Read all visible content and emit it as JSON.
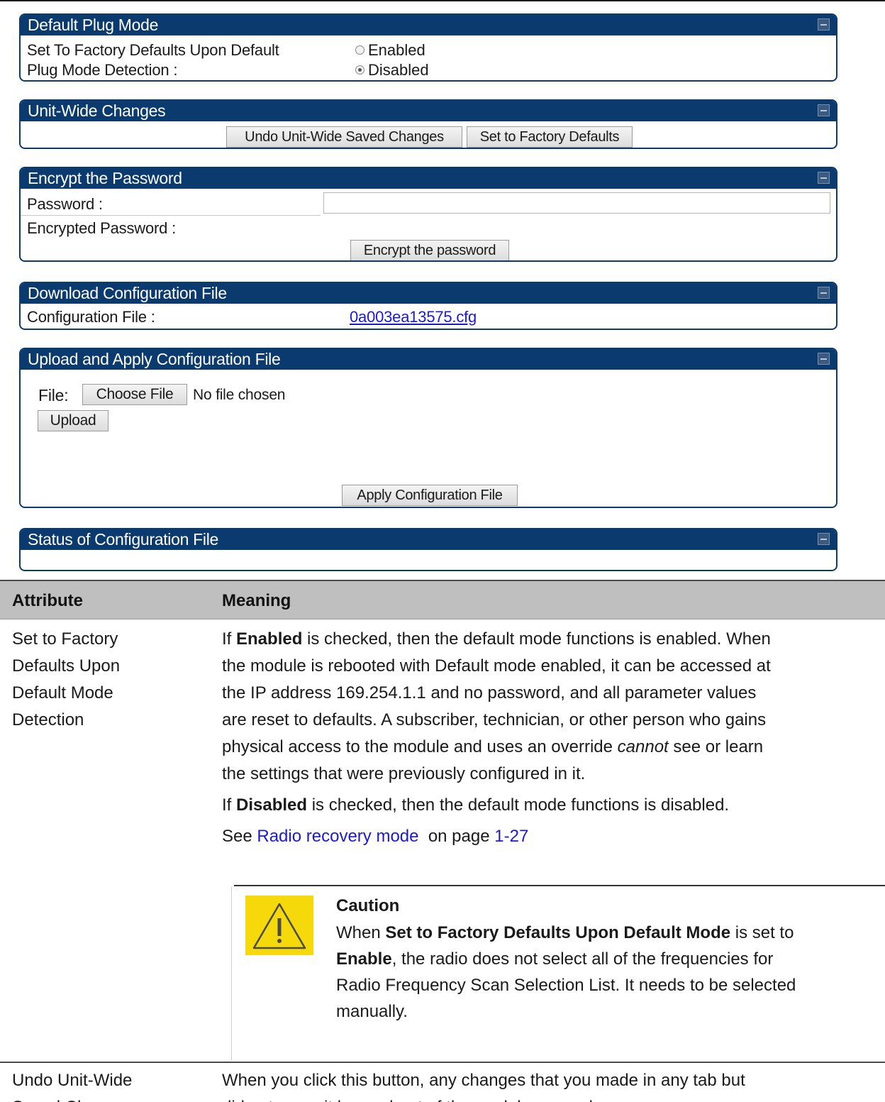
{
  "panels": {
    "default_plug": {
      "title": "Default Plug Mode",
      "label_line1": "Set To Factory Defaults Upon Default",
      "label_line2": "Plug Mode Detection :",
      "option_enabled": "Enabled",
      "option_disabled": "Disabled",
      "selected": "Disabled"
    },
    "unit_wide": {
      "title": "Unit-Wide Changes",
      "undo_button": "Undo Unit-Wide Saved Changes",
      "factory_button": "Set to Factory Defaults"
    },
    "encrypt": {
      "title": "Encrypt the Password",
      "password_label": "Password :",
      "encrypted_label": "Encrypted Password :",
      "encrypt_button": "Encrypt the password"
    },
    "download": {
      "title": "Download Configuration File",
      "file_label": "Configuration File :",
      "file_link": "0a003ea13575.cfg"
    },
    "upload": {
      "title": "Upload and Apply Configuration File",
      "file_label": "File:",
      "choose_button": "Choose File",
      "no_file": "No file chosen",
      "upload_button": "Upload",
      "apply_button": "Apply Configuration File"
    },
    "status": {
      "title": "Status of Configuration File"
    }
  },
  "table": {
    "col_attribute": "Attribute",
    "col_meaning": "Meaning",
    "row1": {
      "attribute_lines": [
        "Set to Factory",
        "Defaults Upon",
        "Default Mode",
        "Detection"
      ],
      "p1_prefix": "If ",
      "p1_bold": "Enabled",
      "p1_rest_line1": " is checked, then the default mode functions is enabled. When",
      "p1_line2": "the module is rebooted with Default mode enabled, it can be accessed at",
      "p1_line3": "the IP address 169.254.1.1 and no password, and all parameter values",
      "p1_line4": "are reset to defaults. A subscriber, technician, or other person who gains",
      "p1_line5_pre": "physical access to the module and uses an override ",
      "p1_line5_italic": "cannot",
      "p1_line5_post": " see or learn",
      "p1_line6": "the settings that were previously configured in it.",
      "p2_prefix": "If ",
      "p2_bold": "Disabled",
      "p2_rest": " is checked, then the default mode functions is disabled.",
      "p3_prefix": "See ",
      "p3_link": "Radio recovery mode",
      "p3_mid": "  on page ",
      "p3_page": "1-27",
      "caution_title": "Caution",
      "caution_pre": "When ",
      "caution_bold1": "Set to Factory Defaults Upon Default Mode",
      "caution_mid": " is set to",
      "caution_bold2": "Enable",
      "caution_rest_line2": ", the radio does not select all of the frequencies for",
      "caution_line3": "Radio Frequency Scan Selection List. It needs to be selected",
      "caution_line4": "manually."
    },
    "row2": {
      "attribute_lines": [
        "Undo Unit-Wide",
        "Saved Changes"
      ],
      "meaning_line1": "When you click this button, any changes that you made in any tab but",
      "meaning_line2": "did not commit by a reboot of the module are undone."
    }
  },
  "colors": {
    "panel_header": "#0a3a6e",
    "table_header": "#bfbfbf",
    "link": "#1a1ad6",
    "caution_yellow": "#f5d90a"
  }
}
